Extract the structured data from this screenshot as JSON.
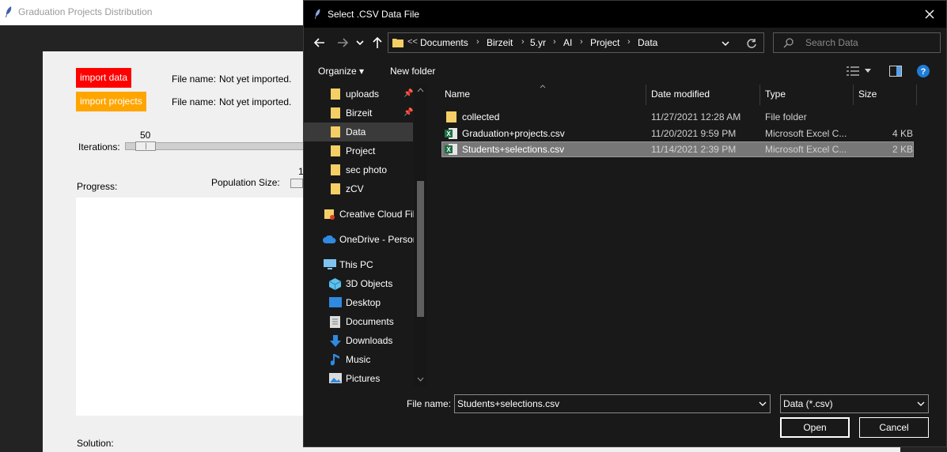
{
  "app": {
    "title": "Graduation Projects Distribution",
    "import_data_label": "import data",
    "import_projects_label": "import projects",
    "file_name_label_1": "File name:",
    "file_status_1": "Not yet imported.",
    "file_name_label_2": "File name:",
    "file_status_2": "Not yet imported.",
    "iterations_value": "50",
    "iterations_label": "Iterations:",
    "progress_label": "Progress:",
    "population_label": "Population Size:",
    "population_value_partial": "1",
    "solution_label": "Solution:"
  },
  "dialog": {
    "title": "Select .CSV Data File",
    "breadcrumb_prefix": "<<",
    "breadcrumbs": [
      "Documents",
      "Birzeit",
      "5.yr",
      "AI",
      "Project",
      "Data"
    ],
    "search_placeholder": "Search Data",
    "organize_label": "Organize",
    "new_folder_label": "New folder",
    "nav_items": [
      {
        "label": "uploads",
        "icon": "folder-icon",
        "pinned": true
      },
      {
        "label": "Birzeit",
        "icon": "folder-icon",
        "pinned": true
      },
      {
        "label": "Data",
        "icon": "folder-icon",
        "selected": true
      },
      {
        "label": "Project",
        "icon": "folder-icon"
      },
      {
        "label": "sec photo",
        "icon": "folder-icon"
      },
      {
        "label": "zCV",
        "icon": "folder-icon"
      },
      {
        "label": "Creative Cloud Fil",
        "icon": "creative-cloud-icon"
      },
      {
        "label": "OneDrive - Person",
        "icon": "onedrive-icon"
      },
      {
        "label": "This PC",
        "icon": "computer-icon"
      },
      {
        "label": "3D Objects",
        "icon": "3d-objects-icon"
      },
      {
        "label": "Desktop",
        "icon": "desktop-icon"
      },
      {
        "label": "Documents",
        "icon": "documents-icon"
      },
      {
        "label": "Downloads",
        "icon": "downloads-icon"
      },
      {
        "label": "Music",
        "icon": "music-icon"
      },
      {
        "label": "Pictures",
        "icon": "pictures-icon"
      }
    ],
    "columns": {
      "name": "Name",
      "date": "Date modified",
      "type": "Type",
      "size": "Size"
    },
    "files": [
      {
        "name": "collected",
        "date": "11/27/2021 12:28 AM",
        "type": "File folder",
        "size": "",
        "icon": "folder-icon"
      },
      {
        "name": "Graduation+projects.csv",
        "date": "11/20/2021 9:59 PM",
        "type": "Microsoft Excel C...",
        "size": "4 KB",
        "icon": "excel-icon"
      },
      {
        "name": "Students+selections.csv",
        "date": "11/14/2021 2:39 PM",
        "type": "Microsoft Excel C...",
        "size": "2 KB",
        "icon": "excel-icon",
        "selected": true
      }
    ],
    "file_name_label": "File name:",
    "file_name_value": "Students+selections.csv",
    "file_type_value": "Data (*.csv)",
    "open_label": "Open",
    "cancel_label": "Cancel"
  },
  "colors": {
    "import_data_bg": "#ff0000",
    "import_projects_bg": "#ffa500",
    "dialog_bg": "#191919",
    "selection": "#777777"
  }
}
